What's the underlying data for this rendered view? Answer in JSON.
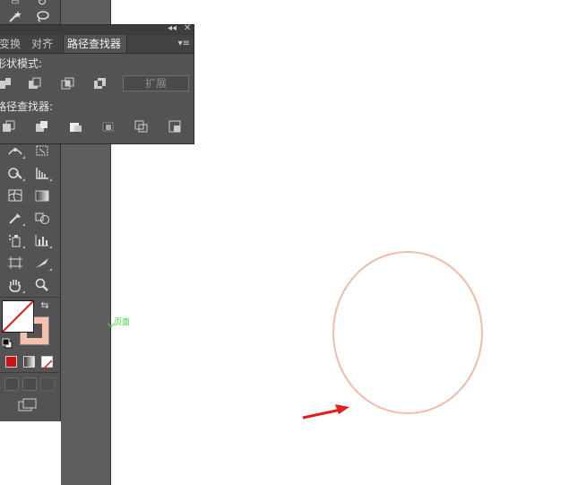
{
  "panel": {
    "tabs": [
      "变换",
      "对齐",
      "路径查找器"
    ],
    "shape_modes_label": "形状模式:",
    "pathfinder_label": "路径查找器:",
    "expand_button": "扩展"
  },
  "artboard": {
    "page_label": "页面"
  },
  "colors": {
    "stroke_color": "#f4c1ad",
    "circle_stroke": "#f2bda8",
    "arrow": "#e41e1e",
    "page_label": "#3cd43c"
  },
  "icons": [
    "magic-wand-icon",
    "lasso-icon",
    "pen-icon",
    "warp-icon",
    "shape-builder-icon",
    "live-paint-icon",
    "mesh-icon",
    "gradient-icon",
    "eyedropper-icon",
    "blend-icon",
    "symbol-sprayer-icon",
    "column-graph-icon",
    "artboard-icon",
    "slice-icon",
    "hand-icon",
    "zoom-icon",
    "swap-icon",
    "default-colors-icon"
  ]
}
